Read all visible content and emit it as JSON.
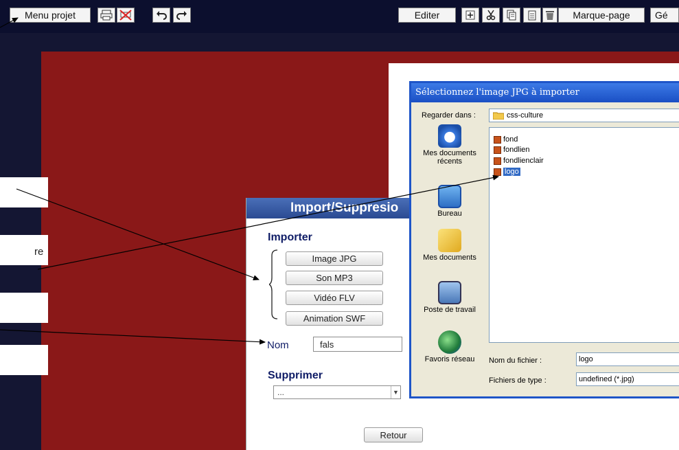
{
  "toolbar": {
    "menu_projet": "Menu projet",
    "editer": "Editer",
    "marque_page": "Marque-page",
    "gen_truncated": "Gé",
    "icons": [
      "print-icon",
      "no-print-icon",
      "undo-icon",
      "redo-icon",
      "add-icon",
      "cut-icon",
      "copy-icon",
      "paste-icon",
      "trash-icon"
    ]
  },
  "callouts": {
    "partial_text": "re"
  },
  "import_dialog": {
    "title": "Import/Suppresio",
    "import_heading": "Importer",
    "buttons": [
      "Image JPG",
      "Son MP3",
      "Vidéo FLV",
      "Animation SWF"
    ],
    "name_label": "Nom",
    "name_value": "fals",
    "delete_heading": "Supprimer",
    "delete_select_value": "...",
    "return_button": "Retour"
  },
  "file_dialog": {
    "title": "Sélectionnez l'image JPG à importer",
    "look_in_label": "Regarder dans :",
    "look_in_value": "css-culture",
    "places": [
      "Mes documents récents",
      "Bureau",
      "Mes documents",
      "Poste de travail",
      "Favoris réseau"
    ],
    "files": [
      "fond",
      "fondlien",
      "fondlienclair",
      "logo"
    ],
    "selected_file": "logo",
    "filename_label": "Nom du fichier :",
    "filename_value": "logo",
    "filetype_label": "Fichiers de type :",
    "filetype_value": "undefined (*.jpg)"
  },
  "colors": {
    "background": "#141633",
    "canvas_red": "#8a1818",
    "dialog_title_blue": "#2a4a92",
    "xp_title_blue": "#1a4fc4",
    "heading_navy": "#0f1c66",
    "selection_blue": "#316ac5"
  }
}
